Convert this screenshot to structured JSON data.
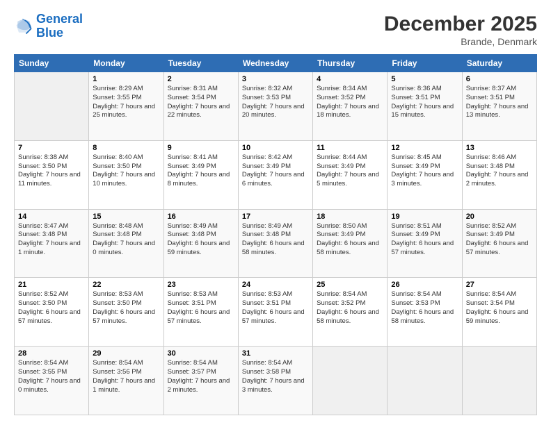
{
  "logo": {
    "line1": "General",
    "line2": "Blue"
  },
  "header": {
    "title": "December 2025",
    "location": "Brande, Denmark"
  },
  "weekdays": [
    "Sunday",
    "Monday",
    "Tuesday",
    "Wednesday",
    "Thursday",
    "Friday",
    "Saturday"
  ],
  "weeks": [
    [
      {
        "day": "",
        "empty": true
      },
      {
        "day": "1",
        "sunrise": "Sunrise: 8:29 AM",
        "sunset": "Sunset: 3:55 PM",
        "daylight": "Daylight: 7 hours and 25 minutes."
      },
      {
        "day": "2",
        "sunrise": "Sunrise: 8:31 AM",
        "sunset": "Sunset: 3:54 PM",
        "daylight": "Daylight: 7 hours and 22 minutes."
      },
      {
        "day": "3",
        "sunrise": "Sunrise: 8:32 AM",
        "sunset": "Sunset: 3:53 PM",
        "daylight": "Daylight: 7 hours and 20 minutes."
      },
      {
        "day": "4",
        "sunrise": "Sunrise: 8:34 AM",
        "sunset": "Sunset: 3:52 PM",
        "daylight": "Daylight: 7 hours and 18 minutes."
      },
      {
        "day": "5",
        "sunrise": "Sunrise: 8:36 AM",
        "sunset": "Sunset: 3:51 PM",
        "daylight": "Daylight: 7 hours and 15 minutes."
      },
      {
        "day": "6",
        "sunrise": "Sunrise: 8:37 AM",
        "sunset": "Sunset: 3:51 PM",
        "daylight": "Daylight: 7 hours and 13 minutes."
      }
    ],
    [
      {
        "day": "7",
        "sunrise": "Sunrise: 8:38 AM",
        "sunset": "Sunset: 3:50 PM",
        "daylight": "Daylight: 7 hours and 11 minutes."
      },
      {
        "day": "8",
        "sunrise": "Sunrise: 8:40 AM",
        "sunset": "Sunset: 3:50 PM",
        "daylight": "Daylight: 7 hours and 10 minutes."
      },
      {
        "day": "9",
        "sunrise": "Sunrise: 8:41 AM",
        "sunset": "Sunset: 3:49 PM",
        "daylight": "Daylight: 7 hours and 8 minutes."
      },
      {
        "day": "10",
        "sunrise": "Sunrise: 8:42 AM",
        "sunset": "Sunset: 3:49 PM",
        "daylight": "Daylight: 7 hours and 6 minutes."
      },
      {
        "day": "11",
        "sunrise": "Sunrise: 8:44 AM",
        "sunset": "Sunset: 3:49 PM",
        "daylight": "Daylight: 7 hours and 5 minutes."
      },
      {
        "day": "12",
        "sunrise": "Sunrise: 8:45 AM",
        "sunset": "Sunset: 3:49 PM",
        "daylight": "Daylight: 7 hours and 3 minutes."
      },
      {
        "day": "13",
        "sunrise": "Sunrise: 8:46 AM",
        "sunset": "Sunset: 3:48 PM",
        "daylight": "Daylight: 7 hours and 2 minutes."
      }
    ],
    [
      {
        "day": "14",
        "sunrise": "Sunrise: 8:47 AM",
        "sunset": "Sunset: 3:48 PM",
        "daylight": "Daylight: 7 hours and 1 minute."
      },
      {
        "day": "15",
        "sunrise": "Sunrise: 8:48 AM",
        "sunset": "Sunset: 3:48 PM",
        "daylight": "Daylight: 7 hours and 0 minutes."
      },
      {
        "day": "16",
        "sunrise": "Sunrise: 8:49 AM",
        "sunset": "Sunset: 3:48 PM",
        "daylight": "Daylight: 6 hours and 59 minutes."
      },
      {
        "day": "17",
        "sunrise": "Sunrise: 8:49 AM",
        "sunset": "Sunset: 3:48 PM",
        "daylight": "Daylight: 6 hours and 58 minutes."
      },
      {
        "day": "18",
        "sunrise": "Sunrise: 8:50 AM",
        "sunset": "Sunset: 3:49 PM",
        "daylight": "Daylight: 6 hours and 58 minutes."
      },
      {
        "day": "19",
        "sunrise": "Sunrise: 8:51 AM",
        "sunset": "Sunset: 3:49 PM",
        "daylight": "Daylight: 6 hours and 57 minutes."
      },
      {
        "day": "20",
        "sunrise": "Sunrise: 8:52 AM",
        "sunset": "Sunset: 3:49 PM",
        "daylight": "Daylight: 6 hours and 57 minutes."
      }
    ],
    [
      {
        "day": "21",
        "sunrise": "Sunrise: 8:52 AM",
        "sunset": "Sunset: 3:50 PM",
        "daylight": "Daylight: 6 hours and 57 minutes."
      },
      {
        "day": "22",
        "sunrise": "Sunrise: 8:53 AM",
        "sunset": "Sunset: 3:50 PM",
        "daylight": "Daylight: 6 hours and 57 minutes."
      },
      {
        "day": "23",
        "sunrise": "Sunrise: 8:53 AM",
        "sunset": "Sunset: 3:51 PM",
        "daylight": "Daylight: 6 hours and 57 minutes."
      },
      {
        "day": "24",
        "sunrise": "Sunrise: 8:53 AM",
        "sunset": "Sunset: 3:51 PM",
        "daylight": "Daylight: 6 hours and 57 minutes."
      },
      {
        "day": "25",
        "sunrise": "Sunrise: 8:54 AM",
        "sunset": "Sunset: 3:52 PM",
        "daylight": "Daylight: 6 hours and 58 minutes."
      },
      {
        "day": "26",
        "sunrise": "Sunrise: 8:54 AM",
        "sunset": "Sunset: 3:53 PM",
        "daylight": "Daylight: 6 hours and 58 minutes."
      },
      {
        "day": "27",
        "sunrise": "Sunrise: 8:54 AM",
        "sunset": "Sunset: 3:54 PM",
        "daylight": "Daylight: 6 hours and 59 minutes."
      }
    ],
    [
      {
        "day": "28",
        "sunrise": "Sunrise: 8:54 AM",
        "sunset": "Sunset: 3:55 PM",
        "daylight": "Daylight: 7 hours and 0 minutes."
      },
      {
        "day": "29",
        "sunrise": "Sunrise: 8:54 AM",
        "sunset": "Sunset: 3:56 PM",
        "daylight": "Daylight: 7 hours and 1 minute."
      },
      {
        "day": "30",
        "sunrise": "Sunrise: 8:54 AM",
        "sunset": "Sunset: 3:57 PM",
        "daylight": "Daylight: 7 hours and 2 minutes."
      },
      {
        "day": "31",
        "sunrise": "Sunrise: 8:54 AM",
        "sunset": "Sunset: 3:58 PM",
        "daylight": "Daylight: 7 hours and 3 minutes."
      },
      {
        "day": "",
        "empty": true
      },
      {
        "day": "",
        "empty": true
      },
      {
        "day": "",
        "empty": true
      }
    ]
  ]
}
